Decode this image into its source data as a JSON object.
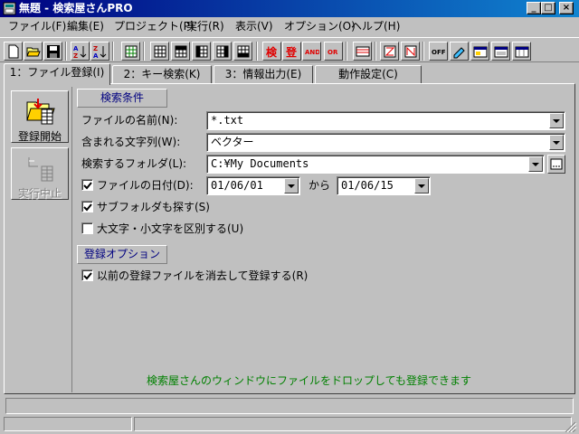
{
  "window": {
    "title": "無題 - 検索屋さんPRO",
    "controls": [
      "_",
      "□",
      "×"
    ]
  },
  "menu": [
    "ファイル(F)",
    "編集(E)",
    "プロジェクト(P)",
    "実行(R)",
    "表示(V)",
    "オプション(O)",
    "ヘルプ(H)"
  ],
  "toolbar": {
    "icons": [
      "new-file-icon",
      "open-folder-icon",
      "save-icon",
      "sort-ascending-icon",
      "sort-descending-icon",
      "grid-icon",
      "table-view-1-icon",
      "table-view-2-icon",
      "table-view-3-icon",
      "table-view-4-icon",
      "table-view-5-icon",
      "search-icon",
      "stop-icon",
      "and-icon",
      "or-icon",
      "filter-icon",
      "z-icon",
      "n-icon",
      "off-icon",
      "edit-icon",
      "window-1-icon",
      "window-2-icon",
      "window-3-icon"
    ],
    "and_label": "AND",
    "or_label": "OR",
    "off_label": "OFF"
  },
  "tabs": [
    {
      "label": "1：ファイル登録(I)",
      "active": true
    },
    {
      "label": "2：キー検索(K)",
      "active": false
    },
    {
      "label": "3：情報出力(E)",
      "active": false
    },
    {
      "label": "動作設定(C)",
      "active": false
    }
  ],
  "side_buttons": {
    "register_label": "登録開始",
    "stop_label": "実行中止"
  },
  "search_conditions": {
    "header": "検索条件",
    "file_name_label": "ファイルの名前(N):",
    "file_name_value": "*.txt",
    "contains_label": "含まれる文字列(W):",
    "contains_value": "ベクター",
    "folder_label": "検索するフォルダ(L):",
    "folder_value": "C:¥My Documents",
    "date_label": "ファイルの日付(D):",
    "date_checked": true,
    "date_from": "01/06/01",
    "date_sep": "から",
    "date_to": "01/06/15",
    "subfolder_label": "サブフォルダも探す(S)",
    "subfolder_checked": true,
    "case_label": "大文字・小文字を区別する(U)",
    "case_checked": false
  },
  "register_options": {
    "header": "登録オプション",
    "clear_label": "以前の登録ファイルを消去して登録する(R)",
    "clear_checked": true
  },
  "hint_text": "検索屋さんのウィンドウにファイルをドロップしても登録できます",
  "colors": {
    "title_start": "#000080",
    "title_end": "#1084d0",
    "face": "#c0c0c0",
    "hint": "#008000",
    "group_text": "#000080"
  }
}
